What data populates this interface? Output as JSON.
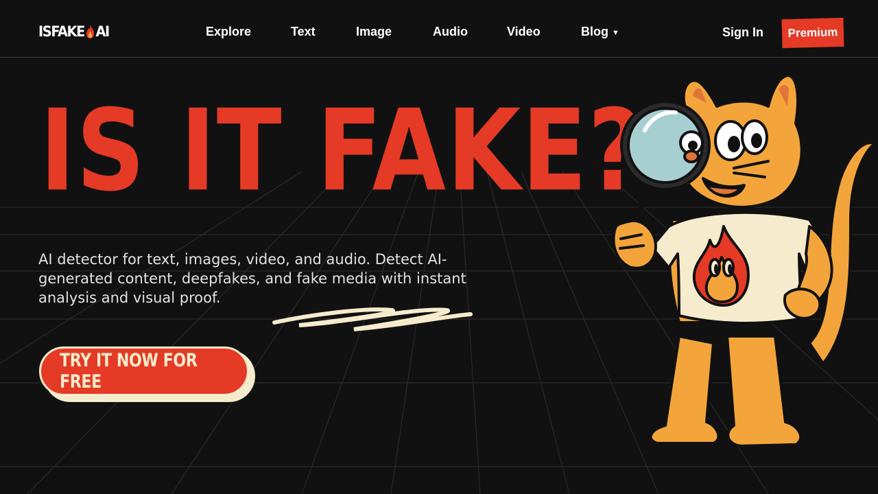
{
  "header": {
    "logo_pre": "ISFAKE",
    "logo_post": "AI",
    "nav": [
      {
        "label": "Explore"
      },
      {
        "label": "Text"
      },
      {
        "label": "Image"
      },
      {
        "label": "Audio"
      },
      {
        "label": "Video"
      },
      {
        "label": "Blog"
      }
    ],
    "blog_caret": "▼",
    "signin_label": "Sign In",
    "premium_label": "Premium"
  },
  "hero": {
    "title": "IS IT FAKE?",
    "subtitle": "AI detector for text, images, video, and audio. Detect AI-generated content, deepfakes, and fake media with instant analysis and visual proof.",
    "cta_label": "TRY IT NOW FOR FREE"
  },
  "colors": {
    "background": "#111111",
    "accent": "#e53a25",
    "cream": "#f6eccd",
    "mascot_orange": "#f3a53c"
  },
  "icons": [
    "flame-logo-icon",
    "chevron-down-icon",
    "cat-mascot-illustration",
    "magnifying-glass-icon"
  ]
}
